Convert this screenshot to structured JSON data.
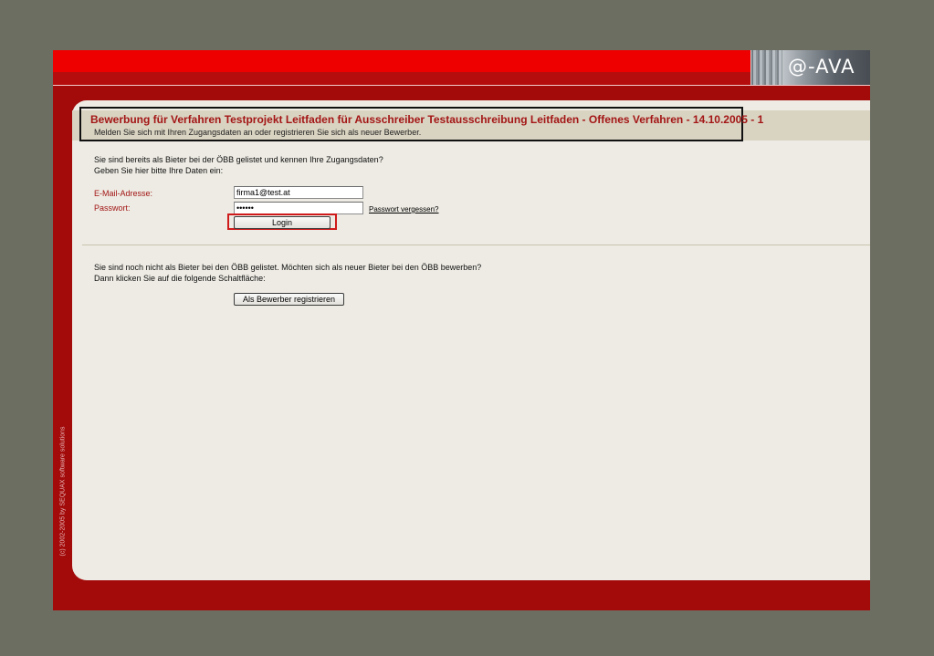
{
  "header": {
    "logo_text": "@-AVA"
  },
  "sidebar": {
    "copyright": "(c) 2002-2005 by SEQUAX software solutions"
  },
  "page": {
    "title": "Bewerbung für Verfahren Testprojekt Leitfaden für Ausschreiber Testausschreibung Leitfaden - Offenes Verfahren - 14.10.2005 - 1",
    "subtitle": "Melden Sie sich mit Ihren Zugangsdaten an oder registrieren Sie sich als neuer Bewerber."
  },
  "login": {
    "intro_line1": "Sie sind bereits als Bieter bei der ÖBB gelistet und kennen Ihre Zugangsdaten?",
    "intro_line2": "Geben Sie hier bitte Ihre Daten ein:",
    "email_label": "E-Mail-Adresse:",
    "email_value": "firma1@test.at",
    "password_label": "Passwort:",
    "password_value": "••••••",
    "forgot_link": "Passwort vergessen?",
    "login_button": "Login"
  },
  "register": {
    "line1": "Sie sind noch nicht als Bieter bei den ÖBB gelistet. Möchten sich als neuer Bieter bei den ÖBB bewerben?",
    "line2": "Dann klicken Sie auf die folgende Schaltfläche:",
    "button": "Als Bewerber registrieren"
  },
  "colors": {
    "background": "#6d6e62",
    "frame_red": "#a30b0b",
    "topbar_red": "#ee0000",
    "content_bg": "#edebe3",
    "title_red": "#a31616",
    "highlight_red": "#cf1b1b"
  }
}
